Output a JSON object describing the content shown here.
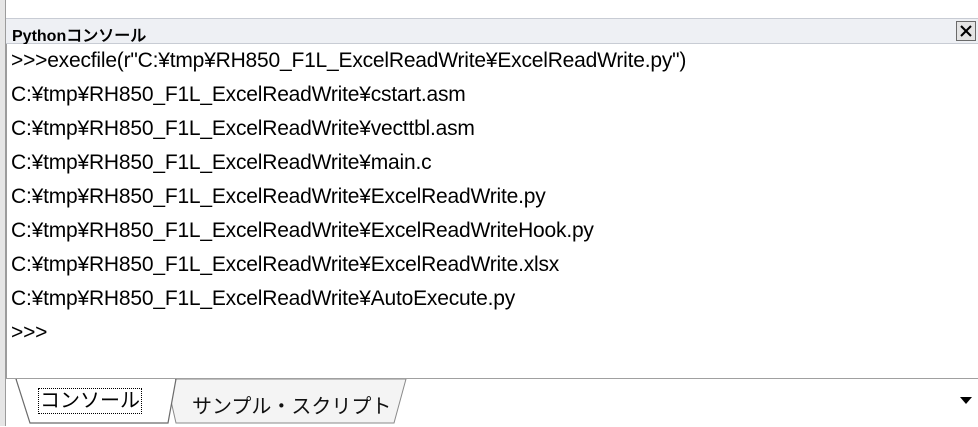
{
  "window": {
    "title": "Pythonコンソール"
  },
  "console": {
    "lines": [
      ">>>execfile(r\"C:¥tmp¥RH850_F1L_ExcelReadWrite¥ExcelReadWrite.py\")",
      "C:¥tmp¥RH850_F1L_ExcelReadWrite¥cstart.asm",
      "C:¥tmp¥RH850_F1L_ExcelReadWrite¥vecttbl.asm",
      "C:¥tmp¥RH850_F1L_ExcelReadWrite¥main.c",
      "C:¥tmp¥RH850_F1L_ExcelReadWrite¥ExcelReadWrite.py",
      "C:¥tmp¥RH850_F1L_ExcelReadWrite¥ExcelReadWriteHook.py",
      "C:¥tmp¥RH850_F1L_ExcelReadWrite¥ExcelReadWrite.xlsx",
      "C:¥tmp¥RH850_F1L_ExcelReadWrite¥AutoExecute.py",
      ">>>"
    ]
  },
  "tabs": [
    {
      "label": "コンソール",
      "active": true
    },
    {
      "label": "サンプル・スクリプト",
      "active": false
    }
  ],
  "icons": {
    "close": "close-icon",
    "tab_menu": "chevron-down-icon"
  }
}
